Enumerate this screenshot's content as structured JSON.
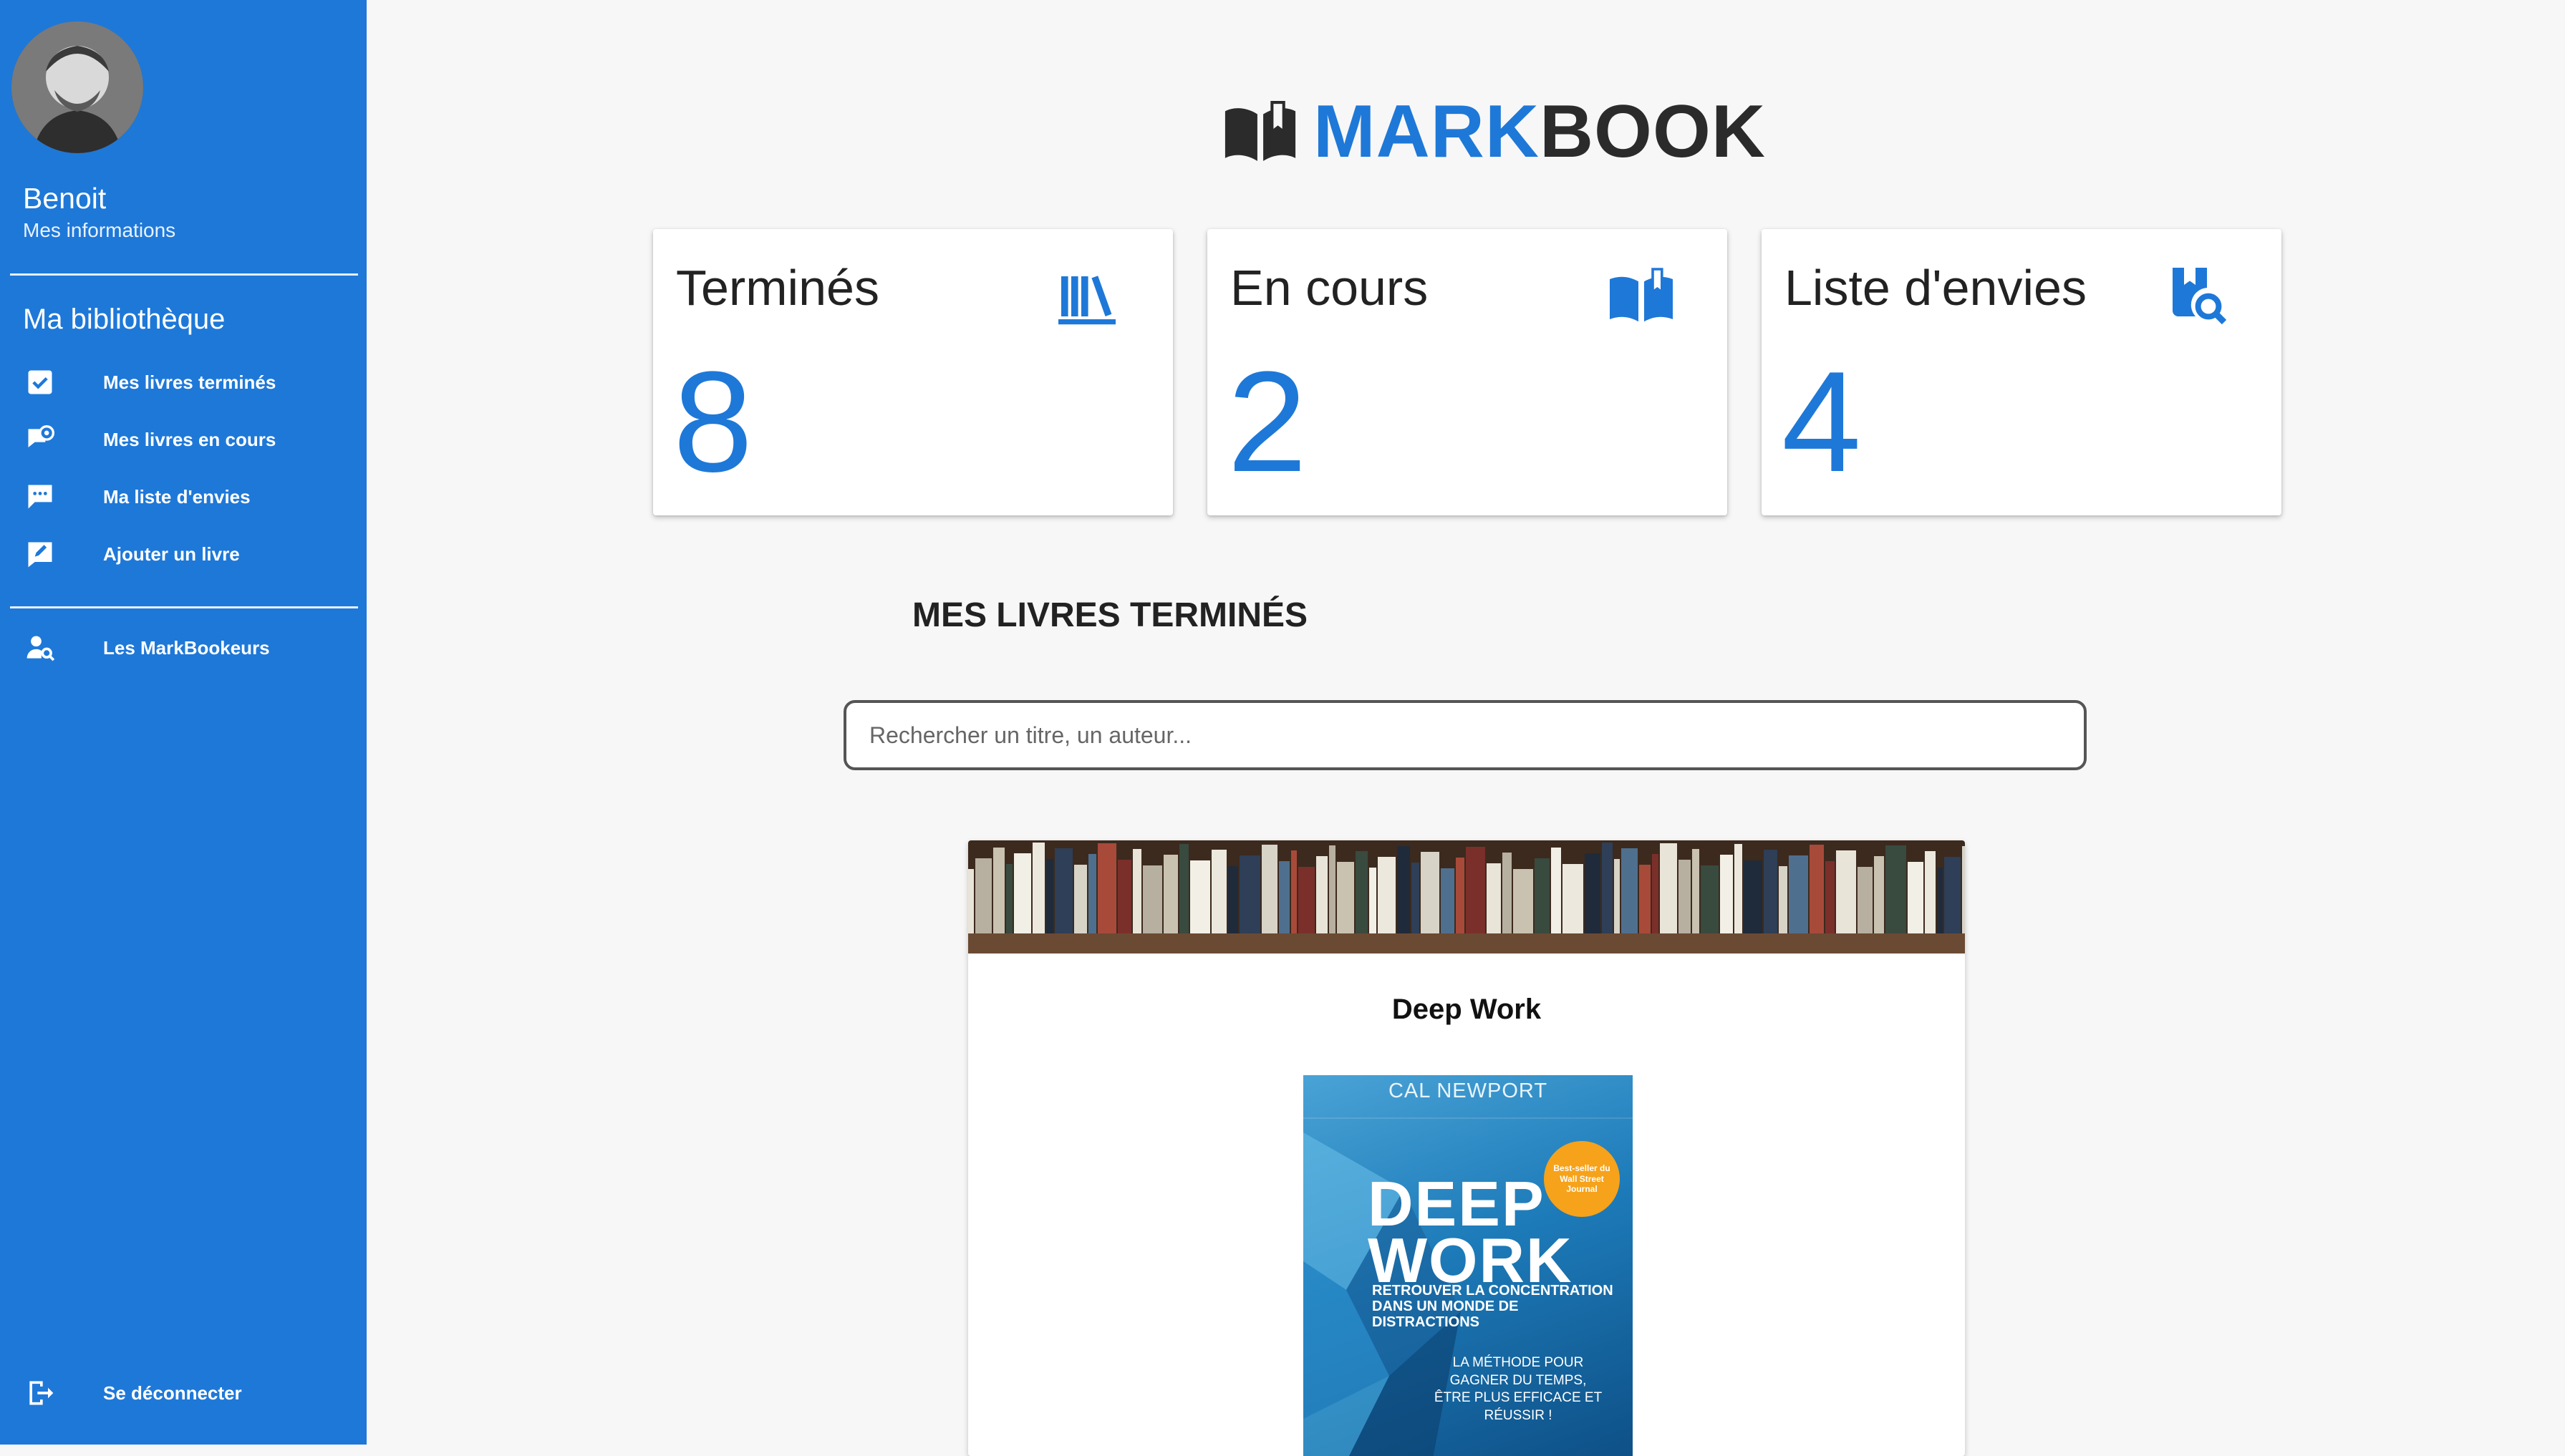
{
  "sidebar": {
    "user_name": "Benoit",
    "user_link": "Mes informations",
    "section_title": "Ma bibliothèque",
    "items": [
      {
        "label": "Mes livres terminés",
        "icon": "checkbox-icon"
      },
      {
        "label": "Mes livres en cours",
        "icon": "eye-comment-icon"
      },
      {
        "label": "Ma liste d'envies",
        "icon": "chat-bubble-icon"
      },
      {
        "label": "Ajouter un livre",
        "icon": "edit-icon"
      }
    ],
    "community": {
      "label": "Les MarkBookeurs",
      "icon": "user-search-icon"
    },
    "logout": {
      "label": "Se déconnecter",
      "icon": "logout-icon"
    }
  },
  "brand": {
    "mark": "MARK",
    "book": "BOOK",
    "icon": "book-reader-icon"
  },
  "stats": [
    {
      "title": "Terminés",
      "count": "8",
      "icon": "bookshelf-icon"
    },
    {
      "title": "En cours",
      "count": "2",
      "icon": "open-book-icon"
    },
    {
      "title": "Liste d'envies",
      "count": "4",
      "icon": "book-search-icon"
    }
  ],
  "section_heading": "MES LIVRES TERMINÉS",
  "search": {
    "placeholder": "Rechercher un titre, un auteur...",
    "value": ""
  },
  "books": [
    {
      "title": "Deep Work",
      "cover": {
        "author": "CAL NEWPORT",
        "title": "DEEP WORK",
        "subtitle": "RETROUVER LA CONCENTRATION DANS UN MONDE DE DISTRACTIONS",
        "badge": "Best-seller du Wall Street Journal",
        "tagline": "LA MÉTHODE POUR GAGNER DU TEMPS, ÊTRE PLUS EFFICACE ET RÉUSSIR !"
      }
    }
  ],
  "colors": {
    "accent": "#1e78d8",
    "text": "#222222",
    "background": "#f7f7f7"
  }
}
